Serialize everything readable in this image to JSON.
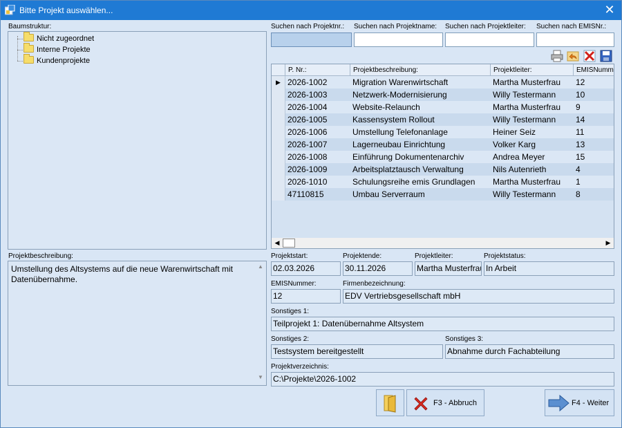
{
  "window": {
    "title": "Bitte Projekt auswählen...",
    "close_glyph": "✕"
  },
  "tree": {
    "label": "Baumstruktur:",
    "items": [
      {
        "label": "Nicht zugeordnet",
        "icon": "folder-icon"
      },
      {
        "label": "Interne Projekte",
        "icon": "folder-icon"
      },
      {
        "label": "Kundenprojekte",
        "icon": "folder-icon"
      }
    ]
  },
  "search": {
    "projektnr_label": "Suchen nach Projektnr.:",
    "projektname_label": "Suchen nach Projektname:",
    "projektleiter_label": "Suchen nach Projektleiter:",
    "emisnr_label": "Suchen nach EMISNr.:",
    "projektnr_value": "",
    "projektname_value": "",
    "projektleiter_value": "",
    "emisnr_value": ""
  },
  "toolbar": {
    "icons": [
      "printer-icon",
      "undo-icon",
      "delete-filter-icon",
      "save-icon"
    ]
  },
  "table": {
    "columns": [
      "P. Nr.:",
      "Projektbeschreibung:",
      "Projektleiter:",
      "EMISNumm"
    ],
    "rows": [
      {
        "nr": "2026-1002",
        "beschreibung": "Migration Warenwirtschaft",
        "leiter": "Martha Musterfrau",
        "emis": "12",
        "selected": true
      },
      {
        "nr": "2026-1003",
        "beschreibung": "Netzwerk-Modernisierung",
        "leiter": "Willy Testermann",
        "emis": "10"
      },
      {
        "nr": "2026-1004",
        "beschreibung": "Website-Relaunch",
        "leiter": "Martha Musterfrau",
        "emis": "9"
      },
      {
        "nr": "2026-1005",
        "beschreibung": "Kassensystem Rollout",
        "leiter": "Willy Testermann",
        "emis": "14"
      },
      {
        "nr": "2026-1006",
        "beschreibung": "Umstellung Telefonanlage",
        "leiter": "Heiner Seiz",
        "emis": "11"
      },
      {
        "nr": "2026-1007",
        "beschreibung": "Lagerneubau Einrichtung",
        "leiter": "Volker Karg",
        "emis": "13"
      },
      {
        "nr": "2026-1008",
        "beschreibung": "Einführung Dokumentenarchiv",
        "leiter": "Andrea Meyer",
        "emis": "15"
      },
      {
        "nr": "2026-1009",
        "beschreibung": "Arbeitsplatztausch Verwaltung",
        "leiter": "Nils Autenrieth",
        "emis": "4"
      },
      {
        "nr": "2026-1010",
        "beschreibung": "Schulungsreihe emis Grundlagen",
        "leiter": "Martha Musterfrau",
        "emis": "1"
      },
      {
        "nr": "47110815",
        "beschreibung": "Umbau Serverraum",
        "leiter": "Willy Testermann",
        "emis": "8"
      }
    ]
  },
  "details": {
    "beschreibung_label": "Projektbeschreibung:",
    "beschreibung_value": "Umstellung des Altsystems auf die neue Warenwirtschaft mit Datenübernahme.",
    "projektstart_label": "Projektstart:",
    "projektstart_value": "02.03.2026",
    "projektende_label": "Projektende:",
    "projektende_value": "30.11.2026",
    "projektleiter_label": "Projektleiter:",
    "projektleiter_value": "Martha Musterfrau",
    "projektstatus_label": "Projektstatus:",
    "projektstatus_value": "In Arbeit",
    "emis_label": "EMISNummer:",
    "emis_value": "12",
    "firma_label": "Firmenbezeichnung:",
    "firma_value": "EDV Vertriebsgesellschaft mbH",
    "sonstiges1_label": "Sonstiges 1:",
    "sonstiges1_value": "Teilprojekt 1: Datenübernahme Altsystem",
    "sonstiges2_label": "Sonstiges 2:",
    "sonstiges2_value": "Testsystem bereitgestellt",
    "sonstiges3_label": "Sonstiges 3:",
    "sonstiges3_value": "Abnahme durch Fachabteilung",
    "verzeichnis_label": "Projektverzeichnis:",
    "verzeichnis_value": "C:\\Projekte\\2026-1002"
  },
  "buttons": {
    "folder_icon": "open-folder-icon",
    "abbruch_label": "F3 - Abbruch",
    "weiter_label": "F4 - Weiter"
  },
  "colors": {
    "titlebar": "#1f7ad4",
    "background": "#d9e6f5",
    "row_alt": "#c9daed"
  }
}
